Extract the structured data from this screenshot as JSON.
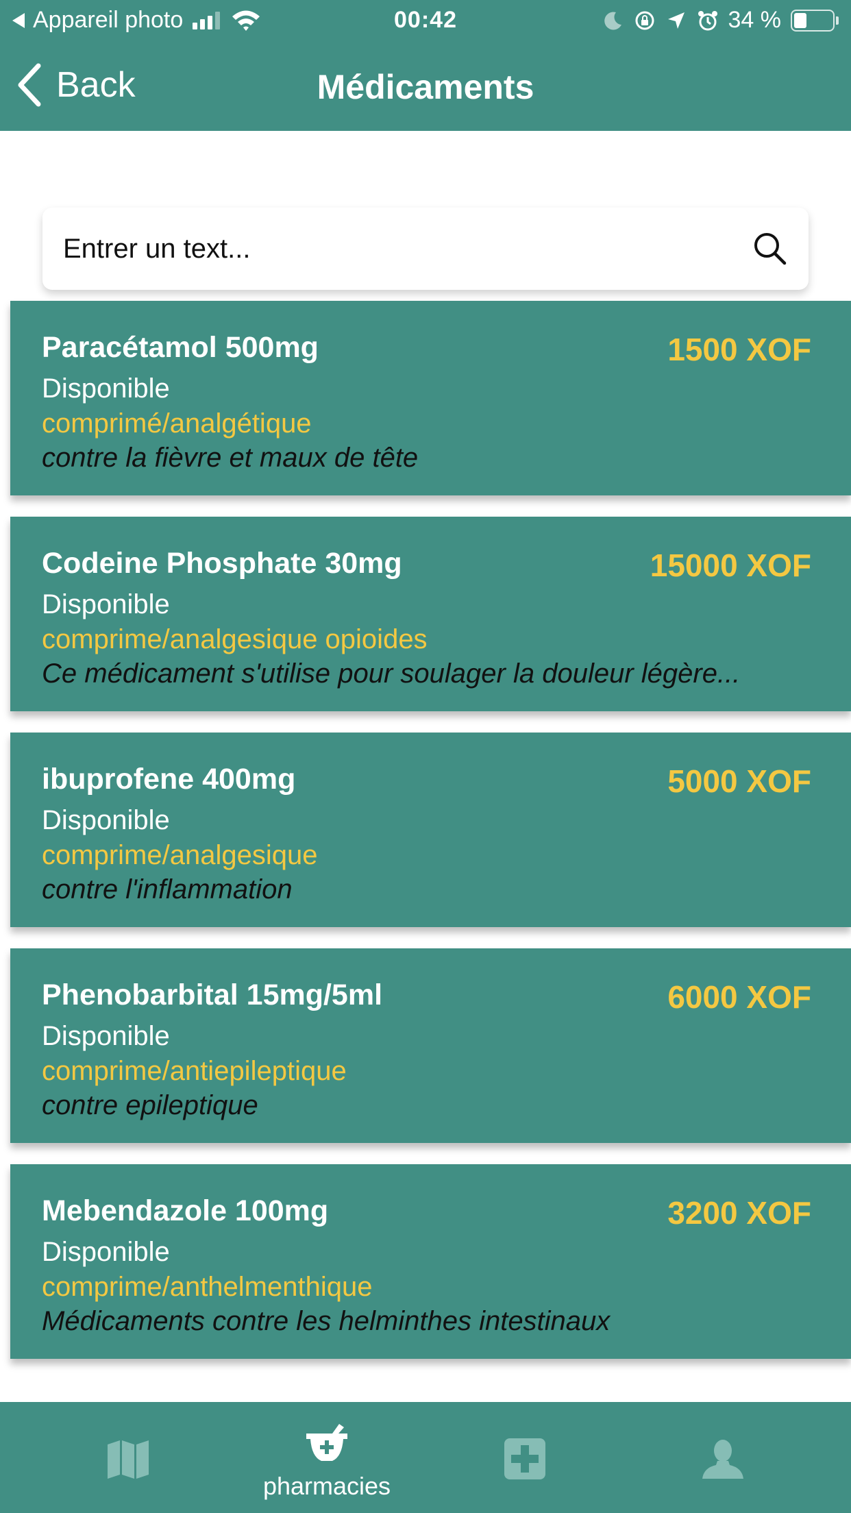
{
  "status_bar": {
    "carrier": "Appareil photo",
    "time": "00:42",
    "battery": "34 %",
    "battery_level": 0.34
  },
  "nav": {
    "back_label": "Back",
    "title": "Médicaments"
  },
  "search": {
    "placeholder": "Entrer un text..."
  },
  "medicaments": [
    {
      "name": "Paracétamol 500mg",
      "price": "1500 XOF",
      "availability": "Disponible",
      "category": "comprimé/analgétique",
      "description": "contre la fièvre et maux de tête"
    },
    {
      "name": "Codeine Phosphate 30mg",
      "price": "15000 XOF",
      "availability": "Disponible",
      "category": "comprime/analgesique opioides",
      "description": "Ce médicament s'utilise pour soulager la douleur légère..."
    },
    {
      "name": "ibuprofene 400mg",
      "price": "5000 XOF",
      "availability": "Disponible",
      "category": "comprime/analgesique",
      "description": "contre l'inflammation"
    },
    {
      "name": "Phenobarbital 15mg/5ml",
      "price": "6000 XOF",
      "availability": "Disponible",
      "category": "comprime/antiepileptique",
      "description": "contre epileptique"
    },
    {
      "name": "Mebendazole 100mg",
      "price": "3200 XOF",
      "availability": "Disponible",
      "category": "comprime/anthelmenthique",
      "description": "Médicaments contre les helminthes intestinaux"
    }
  ],
  "tabbar": {
    "active_label": "pharmacies",
    "icons": [
      "map-icon",
      "mortar-pestle-icon",
      "medical-cross-icon",
      "user-icon"
    ]
  },
  "colors": {
    "primary": "#418f84",
    "accent": "#f4c842",
    "inactive_icon": "#86bdb5"
  }
}
